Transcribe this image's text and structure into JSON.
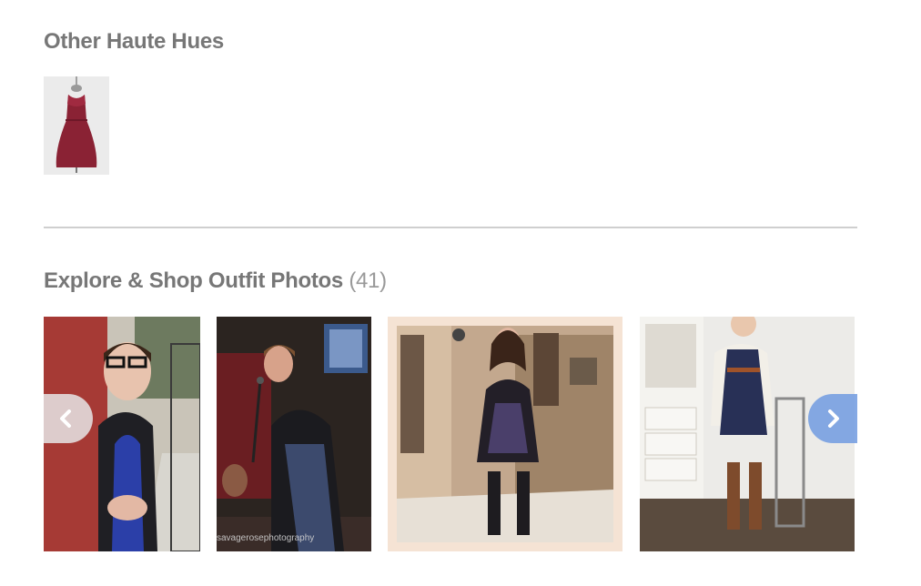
{
  "sections": {
    "hues_title": "Other Haute Hues",
    "explore_title": "Explore & Shop Outfit Photos",
    "explore_count": "(41)"
  },
  "photos": {
    "watermark": "savagerosephotography"
  },
  "icons": {
    "prev": "chevron-left-icon",
    "next": "chevron-right-icon"
  },
  "colors": {
    "title": "#777777",
    "count": "#999999",
    "divider": "#cfcfcf",
    "next_arrow": "#78a0e1",
    "prev_arrow": "#e6e6e6"
  }
}
